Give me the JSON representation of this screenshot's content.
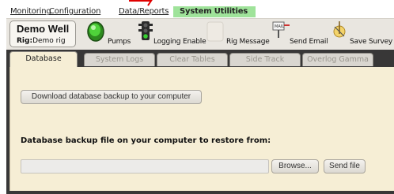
{
  "menu": {
    "monitoring": "Monitoring",
    "configuration": "Configuration",
    "data_reports": "Data/Reports",
    "system_utilities": "System Utilities"
  },
  "well": {
    "name": "Demo Well",
    "rig_label": "Rig:",
    "rig_value": "Demo rig"
  },
  "toolbar": {
    "pumps": "Pumps",
    "logging_enable": "Logging Enable",
    "rig_message": "Rig Message",
    "send_email": "Send Email",
    "save_survey": "Save Survey",
    "icons": [
      "green-light-icon",
      "traffic-light-icon",
      "message-icon",
      "email-icon",
      "survey-icon"
    ]
  },
  "tabs": [
    "Database",
    "System Logs",
    "Clear Tables",
    "Side Track",
    "Overlog Gamma"
  ],
  "active_tab": "Database",
  "database": {
    "download_button": "Download database backup to your computer",
    "restore_label": "Database backup file on your computer to restore from:",
    "file_value": "",
    "browse_button": "Browse...",
    "send_file_button": "Send file"
  },
  "colors": {
    "active_menu_bg": "#9fe39a",
    "panel_bg": "#383737",
    "content_bg": "#f6eed5"
  }
}
